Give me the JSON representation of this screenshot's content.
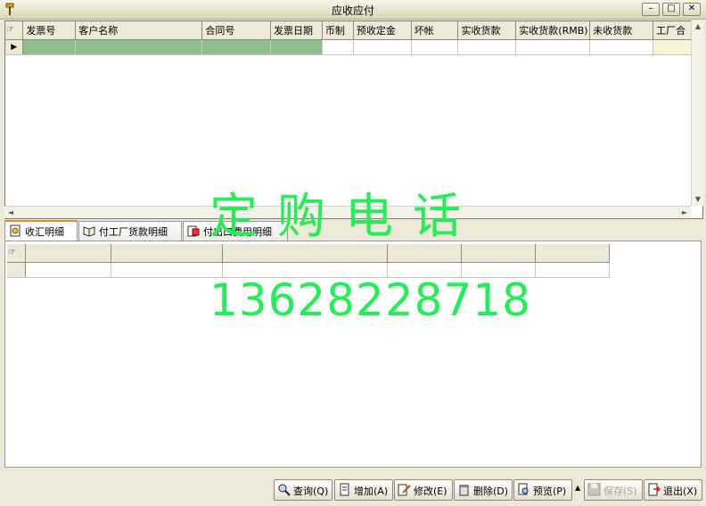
{
  "window": {
    "title": "应收应付"
  },
  "main_grid": {
    "columns": [
      "发票号",
      "客户名称",
      "合同号",
      "发票日期",
      "币制",
      "预收定金",
      "坏帐",
      "实收货款",
      "实收货款(RMB)",
      "未收货款",
      "工厂合"
    ]
  },
  "tabs": [
    {
      "label": "收汇明细",
      "icon": "money-icon"
    },
    {
      "label": "付工厂货款明细",
      "icon": "book-icon"
    },
    {
      "label": "付出口费用明细",
      "icon": "payment-icon"
    }
  ],
  "watermark": {
    "line1": "定购电话",
    "line2": "13628228718"
  },
  "toolbar": {
    "query": "查询(Q)",
    "add": "增加(A)",
    "edit": "修改(E)",
    "delete": "删除(D)",
    "preview": "预览(P)",
    "save": "保存(S)",
    "exit": "退出(X)"
  },
  "colors": {
    "selected_row": "#8cbf8c",
    "watermark": "#22ee55"
  }
}
